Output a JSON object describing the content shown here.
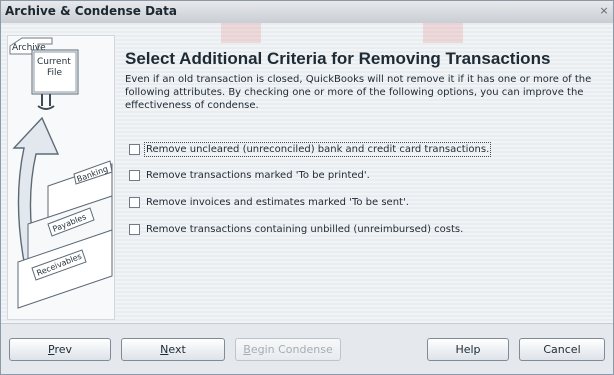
{
  "window": {
    "title": "Archive & Condense Data",
    "close_glyph": "×"
  },
  "illustration": {
    "archive": "Archive",
    "current_line1": "Current",
    "current_line2": "File",
    "tabs": [
      "Banking",
      "Payables",
      "Receivables"
    ]
  },
  "page": {
    "heading": "Select Additional Criteria for Removing Transactions",
    "intro": "Even if an old transaction is closed, QuickBooks will not remove it if it has one or more of the following attributes.  By checking one or more of the following options, you can improve the effectiveness of condense."
  },
  "options": [
    {
      "label": "Remove uncleared (unreconciled) bank and credit card transactions.",
      "checked": false
    },
    {
      "label": "Remove transactions marked 'To be printed'.",
      "checked": false
    },
    {
      "label": "Remove invoices and estimates marked 'To be sent'.",
      "checked": false
    },
    {
      "label": "Remove transactions containing unbilled (unreimbursed) costs.",
      "checked": false
    }
  ],
  "buttons": {
    "prev_key": "P",
    "prev_rest": "rev",
    "next_key": "N",
    "next_rest": "ext",
    "begin_key": "B",
    "begin_rest": "egin Condense",
    "help": "Help",
    "cancel": "Cancel"
  },
  "colors": {
    "accent_watermark": "#e9a5a5",
    "text": "#1e2a34",
    "illustration_arrow": "#e2e8ee"
  }
}
